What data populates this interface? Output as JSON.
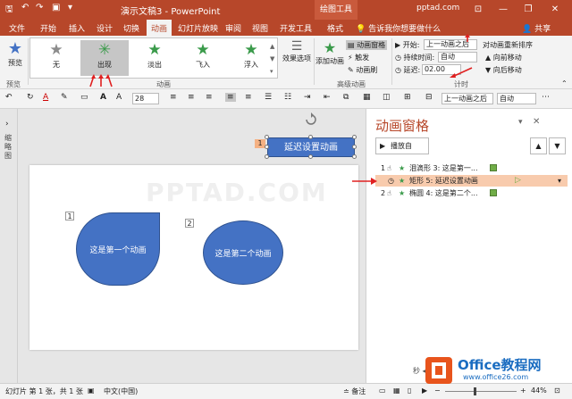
{
  "titlebar": {
    "doc_title": "演示文稿3  -  PowerPoint",
    "tools_tab": "绘图工具",
    "account": "pptad.com"
  },
  "tabs": [
    {
      "label": "文件"
    },
    {
      "label": "开始"
    },
    {
      "label": "插入"
    },
    {
      "label": "设计"
    },
    {
      "label": "切换"
    },
    {
      "label": "动画"
    },
    {
      "label": "幻灯片放映"
    },
    {
      "label": "审阅"
    },
    {
      "label": "视图"
    },
    {
      "label": "开发工具"
    },
    {
      "label": "格式"
    }
  ],
  "tell_me": "告诉我你想要做什么",
  "share": "共享",
  "ribbon": {
    "preview_label": "预览",
    "preview_group": "预览",
    "effects": [
      {
        "label": "无",
        "icon": "star-gray-icon"
      },
      {
        "label": "出现",
        "icon": "star-green-icon"
      },
      {
        "label": "淡出",
        "icon": "star-green-icon"
      },
      {
        "label": "飞入",
        "icon": "star-green-icon"
      },
      {
        "label": "浮入",
        "icon": "star-green-icon"
      }
    ],
    "effect_options": "效果选项",
    "animation_group": "动画",
    "add_animation": "添加动画",
    "anim_pane_btn": "动画窗格",
    "trigger": "触发",
    "anim_painter": "动画刷",
    "advanced_group": "高级动画",
    "start_label": "开始:",
    "start_value": "上一动画之后",
    "duration_label": "持续时间:",
    "duration_value": "自动",
    "delay_label": "延迟:",
    "delay_value": "02.00",
    "timing_group": "计时",
    "reorder_label": "对动画重新排序",
    "move_earlier": "向前移动",
    "move_later": "向后移动"
  },
  "fmtbar": {
    "font_size": "28",
    "start_value": "上一动画之后",
    "duration_value": "自动"
  },
  "thumb_label": "缩略图",
  "slide": {
    "watermark": "PPTAD.COM",
    "shape1_text": "这是第一个动画",
    "shape1_num": "1",
    "shape2_text": "这是第二个动画",
    "shape2_num": "2",
    "selected_text": "延迟设置动画",
    "selected_num": "1"
  },
  "pane": {
    "title": "动画窗格",
    "play_label": "播放自",
    "rows": [
      {
        "num": "1",
        "text": "泪滴形 3: 这是第一..."
      },
      {
        "num": "",
        "text": "矩形 5: 延迟设置动画"
      },
      {
        "num": "2",
        "text": "椭圆 4: 这是第二个..."
      }
    ],
    "seconds_label": "秒"
  },
  "status": {
    "slide_info": "幻灯片 第 1 张，共 1 张",
    "language": "中文(中国)",
    "notes": "备注",
    "zoom": "44%"
  },
  "logo": {
    "text": "Office教程网",
    "url_text": "www.office26.com"
  },
  "colors": {
    "brand": "#b7472a",
    "shape_blue": "#4472c4",
    "selected_row": "#f8cbad",
    "timing_bar": "#70ad47"
  }
}
